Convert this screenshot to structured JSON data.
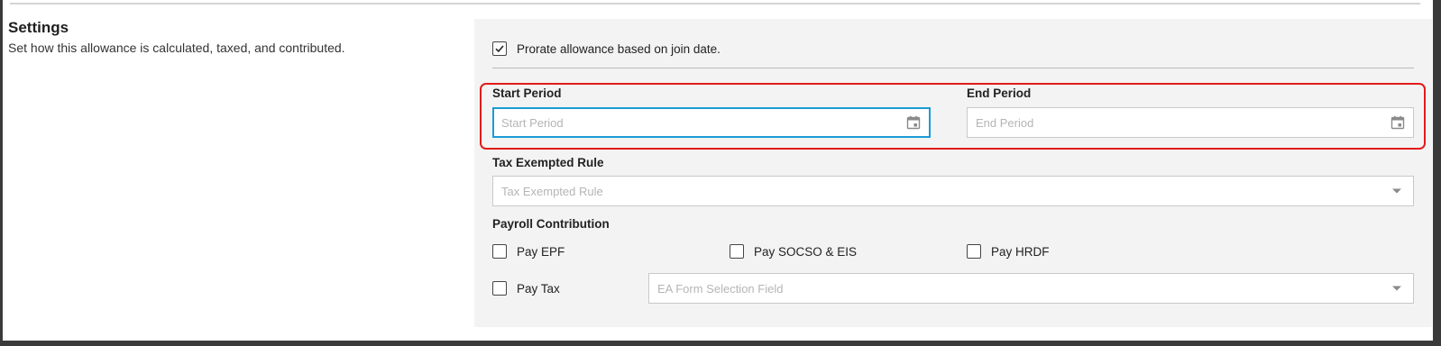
{
  "settings": {
    "title": "Settings",
    "description": "Set how this allowance is calculated, taxed, and contributed."
  },
  "prorate": {
    "label": "Prorate allowance based on join date.",
    "checked": true
  },
  "start_period": {
    "label": "Start Period",
    "placeholder": "Start Period",
    "value": ""
  },
  "end_period": {
    "label": "End Period",
    "placeholder": "End Period",
    "value": ""
  },
  "tax_exempted_rule": {
    "label": "Tax Exempted Rule",
    "placeholder": "Tax Exempted Rule"
  },
  "payroll_contribution": {
    "label": "Payroll Contribution",
    "pay_epf": "Pay EPF",
    "pay_socso_eis": "Pay SOCSO & EIS",
    "pay_hrdf": "Pay HRDF",
    "pay_tax": "Pay Tax"
  },
  "ea_form": {
    "placeholder": "EA Form Selection Field"
  },
  "colors": {
    "focus_border": "#1a9bd7",
    "highlight_border": "#e31b1b",
    "panel_background": "#f3f3f3"
  },
  "icons": [
    "checkmark-icon",
    "calendar-icon",
    "chevron-down-icon"
  ]
}
